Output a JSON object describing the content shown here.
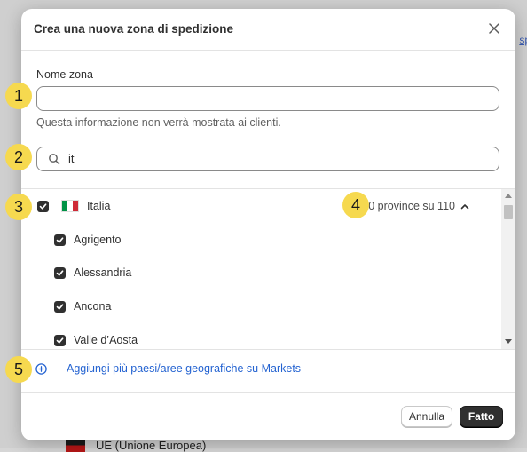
{
  "background": {
    "link_text": "sp",
    "row_label": "UE (Unione Europea)"
  },
  "modal": {
    "title": "Crea una nuova zona di spedizione",
    "name_label": "Nome zona",
    "name_value": "",
    "name_help": "Questa informazione non verrà mostrata ai clienti.",
    "search_value": "it",
    "country": {
      "name": "Italia",
      "checked": true,
      "province_summary": "110 province su 110"
    },
    "provinces": [
      {
        "name": "Agrigento",
        "checked": true
      },
      {
        "name": "Alessandria",
        "checked": true
      },
      {
        "name": "Ancona",
        "checked": true
      },
      {
        "name": "Valle d’Aosta",
        "checked": true
      }
    ],
    "add_link": "Aggiungi più paesi/aree geografiche su Markets",
    "cancel_label": "Annulla",
    "done_label": "Fatto"
  },
  "markers": [
    "1",
    "2",
    "3",
    "4",
    "5"
  ],
  "colors": {
    "marker": "#f6d94f",
    "link": "#2463d1",
    "primary_button": "#303030",
    "flag_green": "#009246",
    "flag_white": "#ffffff",
    "flag_red": "#ce2b37"
  },
  "icons": {
    "close": "close-icon",
    "search": "search-icon",
    "checkbox": "checkmark-icon",
    "collapse": "chevron-up-icon",
    "add": "plus-circle-icon"
  }
}
